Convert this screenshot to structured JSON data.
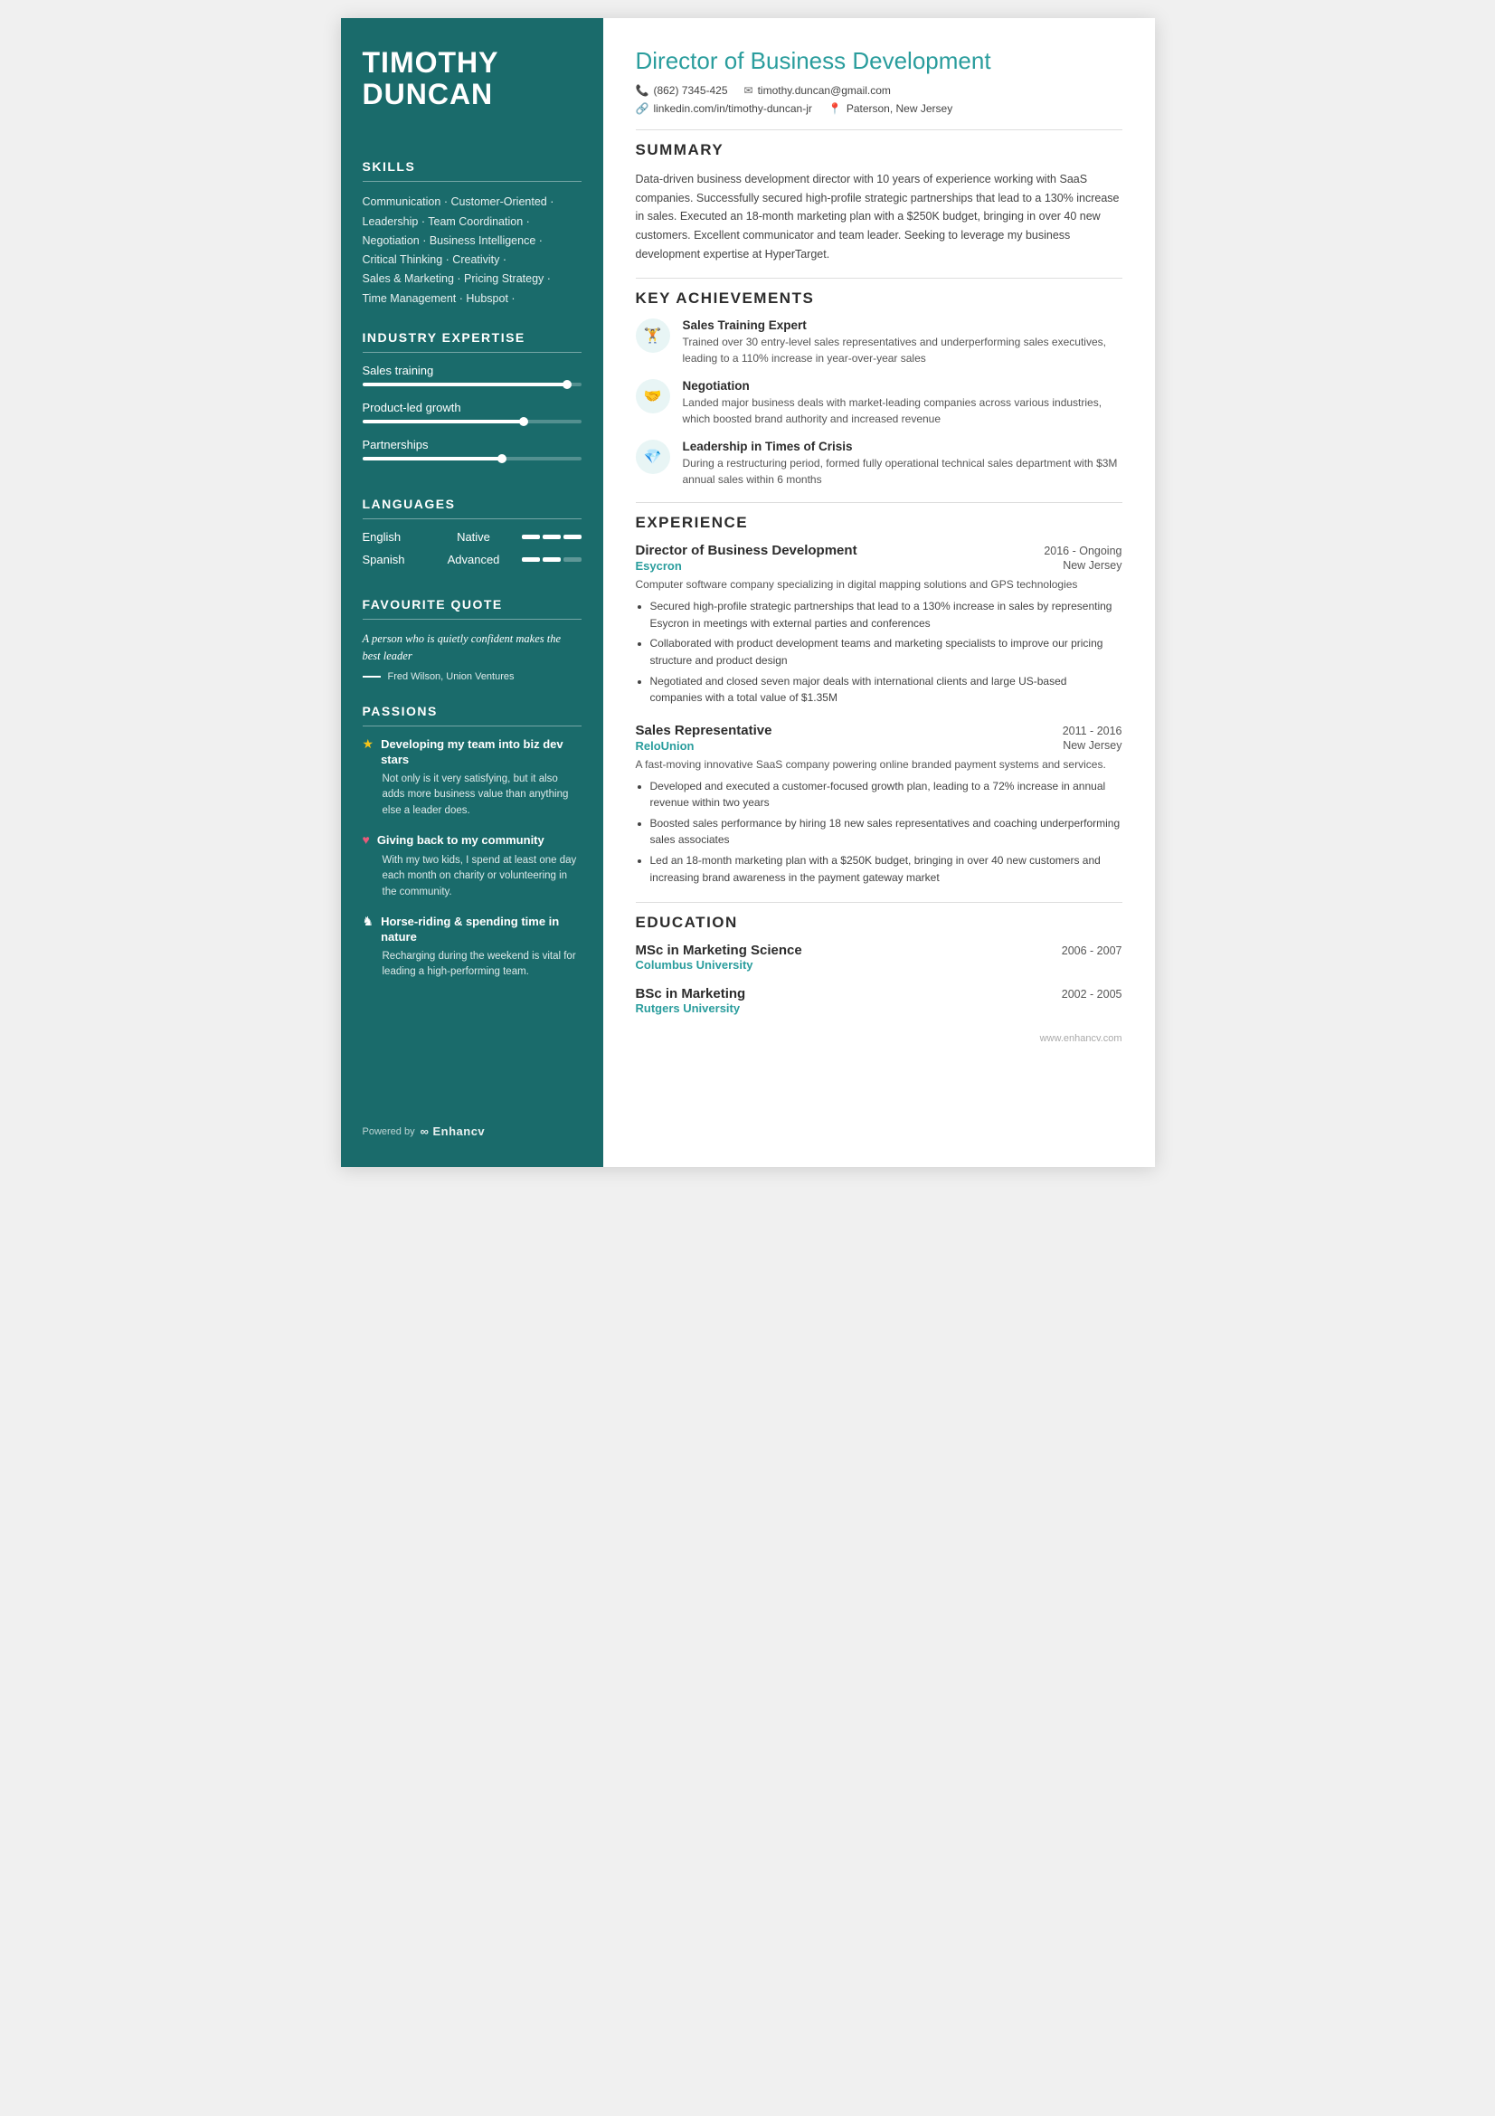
{
  "candidate": {
    "first_name": "TIMOTHY",
    "last_name": "DUNCAN",
    "title": "Director of Business Development",
    "phone": "(862) 7345-425",
    "email": "timothy.duncan@gmail.com",
    "linkedin": "linkedin.com/in/timothy-duncan-jr",
    "location": "Paterson, New Jersey"
  },
  "sidebar": {
    "skills_title": "SKILLS",
    "skills_text": "Communication · Customer-Oriented ·\nLeadership · Team Coordination ·\nNegotiation · Business Intelligence ·\nCritical Thinking · Creativity ·\nSales & Marketing · Pricing Strategy ·\nTime Management · Hubspot ·",
    "expertise_title": "INDUSTRY EXPERTISE",
    "expertise_items": [
      {
        "label": "Sales training",
        "pct": 95
      },
      {
        "label": "Product-led growth",
        "pct": 75
      },
      {
        "label": "Partnerships",
        "pct": 65
      }
    ],
    "languages_title": "LANGUAGES",
    "languages": [
      {
        "name": "English",
        "level": "Native",
        "filled": 3,
        "total": 3
      },
      {
        "name": "Spanish",
        "level": "Advanced",
        "filled": 2,
        "total": 3
      }
    ],
    "quote_title": "FAVOURITE QUOTE",
    "quote_text": "A person who is quietly confident makes the best leader",
    "quote_author": "Fred Wilson, Union Ventures",
    "passions_title": "PASSIONS",
    "passions": [
      {
        "icon": "★",
        "title": "Developing my team into biz dev stars",
        "desc": "Not only is it very satisfying, but it also adds more business value than anything else a leader does."
      },
      {
        "icon": "♥",
        "title": "Giving back to my community",
        "desc": "With my two kids, I spend at least one day each month on charity or volunteering in the community."
      },
      {
        "icon": "♞",
        "title": "Horse-riding & spending time in nature",
        "desc": "Recharging during the weekend is vital for leading a high-performing team."
      }
    ],
    "powered_label": "Powered by",
    "powered_brand": "∞ Enhancv"
  },
  "summary": {
    "title": "SUMMARY",
    "text": "Data-driven business development director with 10 years of experience working with SaaS companies. Successfully secured high-profile strategic partnerships that lead to a 130% increase in sales. Executed an 18-month marketing plan with a $250K budget, bringing in over 40 new customers. Excellent communicator and team leader. Seeking to leverage my business development expertise at HyperTarget."
  },
  "achievements": {
    "title": "KEY ACHIEVEMENTS",
    "items": [
      {
        "icon": "🏋",
        "title": "Sales Training Expert",
        "desc": "Trained over 30 entry-level sales representatives and underperforming sales executives, leading to a 110% increase in year-over-year sales"
      },
      {
        "icon": "🤝",
        "title": "Negotiation",
        "desc": "Landed major business deals with market-leading companies across various industries, which boosted brand authority and increased revenue"
      },
      {
        "icon": "💎",
        "title": "Leadership in Times of Crisis",
        "desc": "During a restructuring period, formed fully operational technical sales department with $3M annual sales within 6 months"
      }
    ]
  },
  "experience": {
    "title": "EXPERIENCE",
    "items": [
      {
        "job_title": "Director of Business Development",
        "date": "2016 - Ongoing",
        "company": "Esycron",
        "location": "New Jersey",
        "description": "Computer software company specializing in digital mapping solutions and GPS technologies",
        "bullets": [
          "Secured high-profile strategic partnerships that lead to a 130% increase in sales by representing Esycron in meetings with external parties and conferences",
          "Collaborated with product development teams and marketing specialists to improve our pricing structure and product design",
          "Negotiated and closed seven major deals with international clients and large US-based companies with a total value of $1.35M"
        ]
      },
      {
        "job_title": "Sales Representative",
        "date": "2011 - 2016",
        "company": "ReloUnion",
        "location": "New Jersey",
        "description": "A fast-moving innovative SaaS company powering online branded payment systems and services.",
        "bullets": [
          "Developed and executed a customer-focused growth plan, leading to a 72% increase in annual revenue within two years",
          "Boosted sales performance by hiring 18 new sales representatives and coaching underperforming sales associates",
          "Led an 18-month marketing plan with a $250K budget, bringing in over 40 new customers and increasing brand awareness in the payment gateway market"
        ]
      }
    ]
  },
  "education": {
    "title": "EDUCATION",
    "items": [
      {
        "degree": "MSc in Marketing Science",
        "date": "2006 - 2007",
        "school": "Columbus University"
      },
      {
        "degree": "BSc in Marketing",
        "date": "2002 - 2005",
        "school": "Rutgers University"
      }
    ]
  },
  "footer": {
    "website": "www.enhancv.com"
  }
}
